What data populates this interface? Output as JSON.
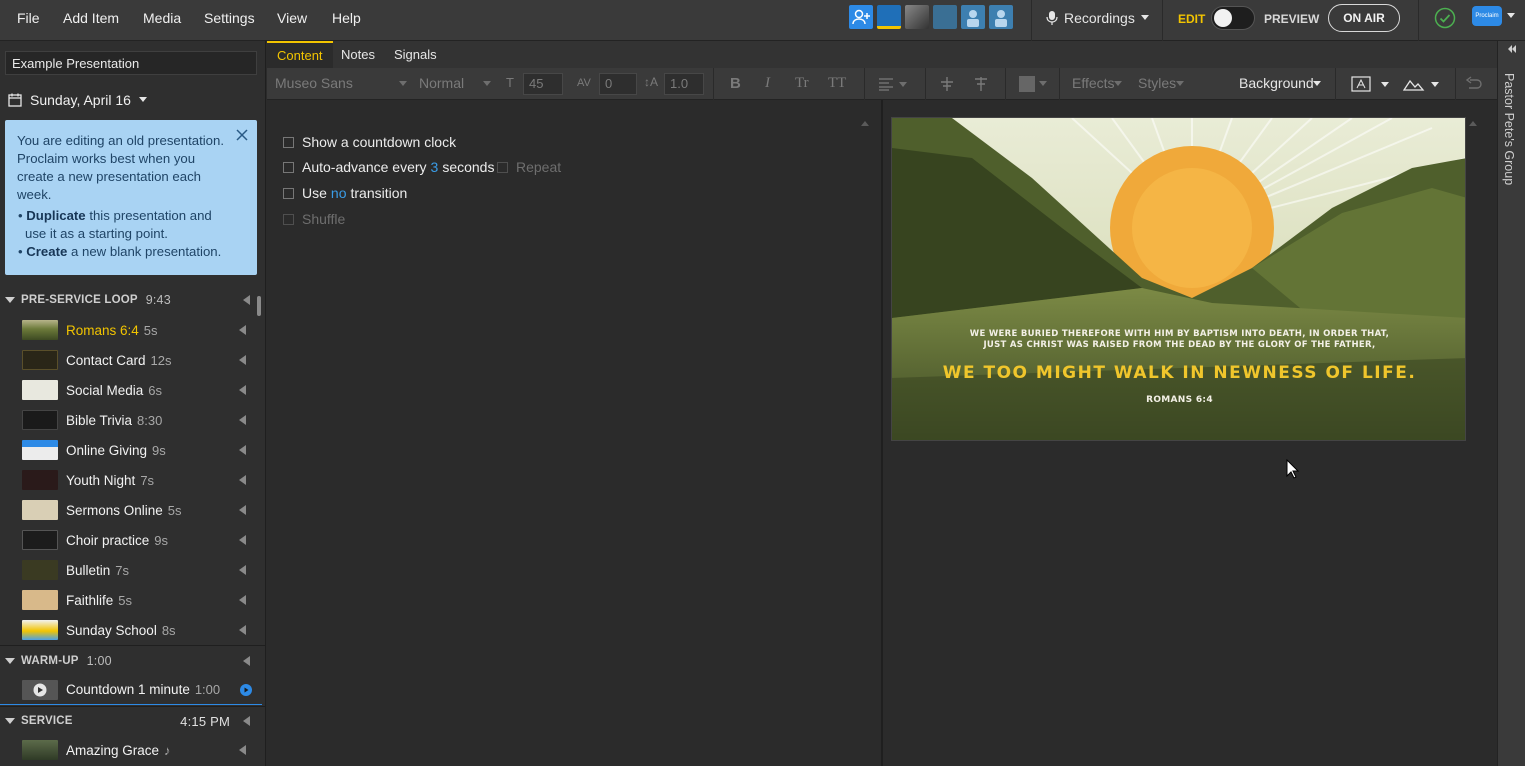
{
  "menu": {
    "file": "File",
    "add_item": "Add Item",
    "media": "Media",
    "settings": "Settings",
    "view": "View",
    "help": "Help"
  },
  "header": {
    "recordings": "Recordings",
    "edit": "EDIT",
    "preview": "PREVIEW",
    "on_air": "ON AIR",
    "brand_badge": "Proclaim"
  },
  "sidebar": {
    "presentation_name": "Example Presentation",
    "date": "Sunday, April 16",
    "notice": {
      "text": "You are editing an old presentation. Proclaim works best when you create a new presentation each week.",
      "duplicate_bold": "Duplicate",
      "duplicate_rest": "this presentation and use it as a starting point.",
      "create_bold": "Create",
      "create_rest": "a new blank presentation."
    },
    "sections": [
      {
        "name": "PRE-SERVICE LOOP",
        "time": "9:43",
        "items": [
          {
            "name": "Romans 6:4",
            "duration": "5s",
            "active": true
          },
          {
            "name": "Contact Card",
            "duration": "12s"
          },
          {
            "name": "Social Media",
            "duration": "6s"
          },
          {
            "name": "Bible Trivia",
            "duration": "8:30"
          },
          {
            "name": "Online Giving",
            "duration": "9s"
          },
          {
            "name": "Youth Night",
            "duration": "7s"
          },
          {
            "name": "Sermons Online",
            "duration": "5s"
          },
          {
            "name": "Choir practice",
            "duration": "9s"
          },
          {
            "name": "Bulletin",
            "duration": "7s"
          },
          {
            "name": "Faithlife",
            "duration": "5s"
          },
          {
            "name": "Sunday School",
            "duration": "8s"
          }
        ]
      },
      {
        "name": "WARM-UP",
        "time": "1:00",
        "items": [
          {
            "name": "Countdown 1 minute",
            "duration": "1:00"
          }
        ]
      },
      {
        "name": "SERVICE",
        "time": "4:15 PM",
        "items": [
          {
            "name": "Amazing Grace",
            "duration": "♪"
          }
        ]
      }
    ]
  },
  "tabs": {
    "content": "Content",
    "notes": "Notes",
    "signals": "Signals"
  },
  "toolbar": {
    "font": "Museo Sans",
    "weight": "Normal",
    "size": "45",
    "spacing": "0",
    "line_height": "1.0",
    "bold": "B",
    "italic": "I",
    "tr": "Tr",
    "tt": "TT",
    "effects": "Effects",
    "styles": "Styles",
    "background": "Background"
  },
  "options": {
    "countdown": "Show a countdown clock",
    "auto_prefix": "Auto-advance every",
    "auto_value": "3",
    "auto_suffix": "seconds",
    "repeat": "Repeat",
    "use_prefix": "Use",
    "use_value": "no",
    "use_suffix": "transition",
    "shuffle": "Shuffle"
  },
  "slide": {
    "line1": "WE WERE BURIED THEREFORE WITH HIM BY BAPTISM INTO DEATH, IN ORDER THAT,",
    "line2": "JUST AS CHRIST WAS RAISED FROM THE DEAD BY THE GLORY OF THE FATHER,",
    "big": "WE TOO MIGHT WALK IN NEWNESS OF LIFE.",
    "ref": "ROMANS 6:4"
  },
  "edge": {
    "group": "Pastor Pete's Group"
  },
  "colors": {
    "accent_yellow": "#f2c400",
    "link_blue": "#3a9ce6",
    "notice_bg": "#a9d3f3"
  }
}
